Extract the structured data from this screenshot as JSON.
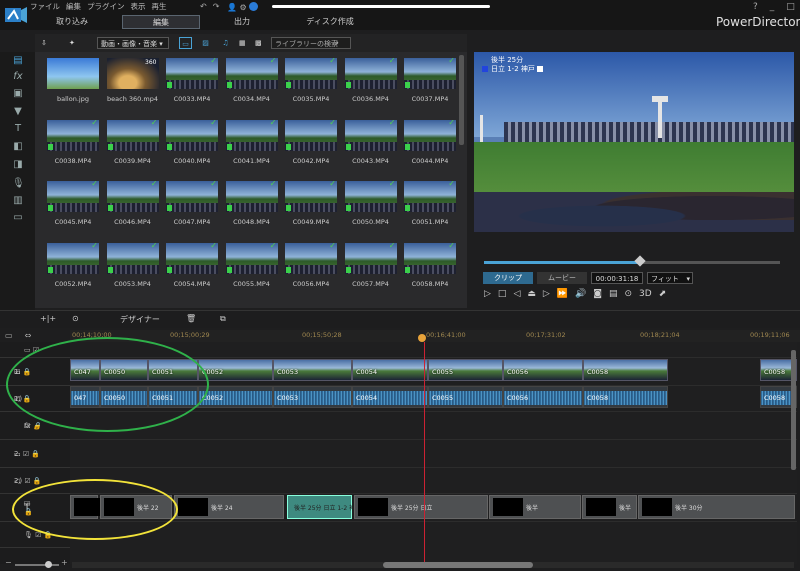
{
  "app": {
    "title": "PowerDirector"
  },
  "menu": [
    "ファイル",
    "編集",
    "プラグイン",
    "表示",
    "再生"
  ],
  "window_controls": [
    "?",
    "_",
    "□",
    "✕"
  ],
  "tabs": [
    {
      "label": "取り込み",
      "active": false
    },
    {
      "label": "編集",
      "active": true
    },
    {
      "label": "出力",
      "active": false
    },
    {
      "label": "ディスク作成",
      "active": false
    }
  ],
  "library": {
    "filter": "動画・画像・音楽",
    "search_placeholder": "ライブラリーの検索",
    "items": [
      "ballon.jpg",
      "beach 360.mp4",
      "C0033.MP4",
      "C0034.MP4",
      "C0035.MP4",
      "C0036.MP4",
      "C0037.MP4",
      "C0038.MP4",
      "C0039.MP4",
      "C0040.MP4",
      "C0041.MP4",
      "C0042.MP4",
      "C0043.MP4",
      "C0044.MP4",
      "C0045.MP4",
      "C0046.MP4",
      "C0047.MP4",
      "C0048.MP4",
      "C0049.MP4",
      "C0050.MP4",
      "C0051.MP4",
      "C0052.MP4",
      "C0053.MP4",
      "C0054.MP4",
      "C0055.MP4",
      "C0056.MP4",
      "C0057.MP4",
      "C0058.MP4"
    ],
    "badge_360": "360"
  },
  "preview": {
    "caption_line1": "後半 25分",
    "caption_line2": "日立 1-2 神戸",
    "tab_clip": "クリップ",
    "tab_movie": "ムービー",
    "timecode": "00:00:31:18",
    "fit": "フィット",
    "mode_3d": "3D",
    "progress": 0.53
  },
  "midbar": {
    "designer": "デザイナー"
  },
  "ruler": {
    "labels": [
      "00;14;10;00",
      "00;15;00;29",
      "00;15;50;28",
      "00;16;41;00",
      "00;17;31;02",
      "00;18;21;04",
      "00;19;11;06"
    ]
  },
  "tracks": {
    "video_label": "1.",
    "audio_label": "1.",
    "fx_label": "fx",
    "video2_label": "2.",
    "audio2_label": "2.",
    "title_label": "T"
  },
  "video_clips": [
    "C047",
    "C0050",
    "C0051",
    "C0052",
    "C0053",
    "C0054",
    "C0055",
    "C0056",
    "C0058",
    "C0058"
  ],
  "audio_clips": [
    "047",
    "C0050",
    "C0051",
    "C0052",
    "C0053",
    "C0054",
    "C0055",
    "C0056",
    "C0058",
    "C0058"
  ],
  "title_clips": [
    "後半 25分",
    "後半 22",
    "後半 24",
    "後半 25分 日立 1-2 神戸 ■",
    "後半 25分 日立",
    "後半",
    "後半",
    "後半 30分"
  ],
  "colors": {
    "accent": "#4aa3d6",
    "playhead": "#cc2233",
    "ellipse_green": "#2fb14a",
    "ellipse_yellow": "#f2e33a"
  }
}
